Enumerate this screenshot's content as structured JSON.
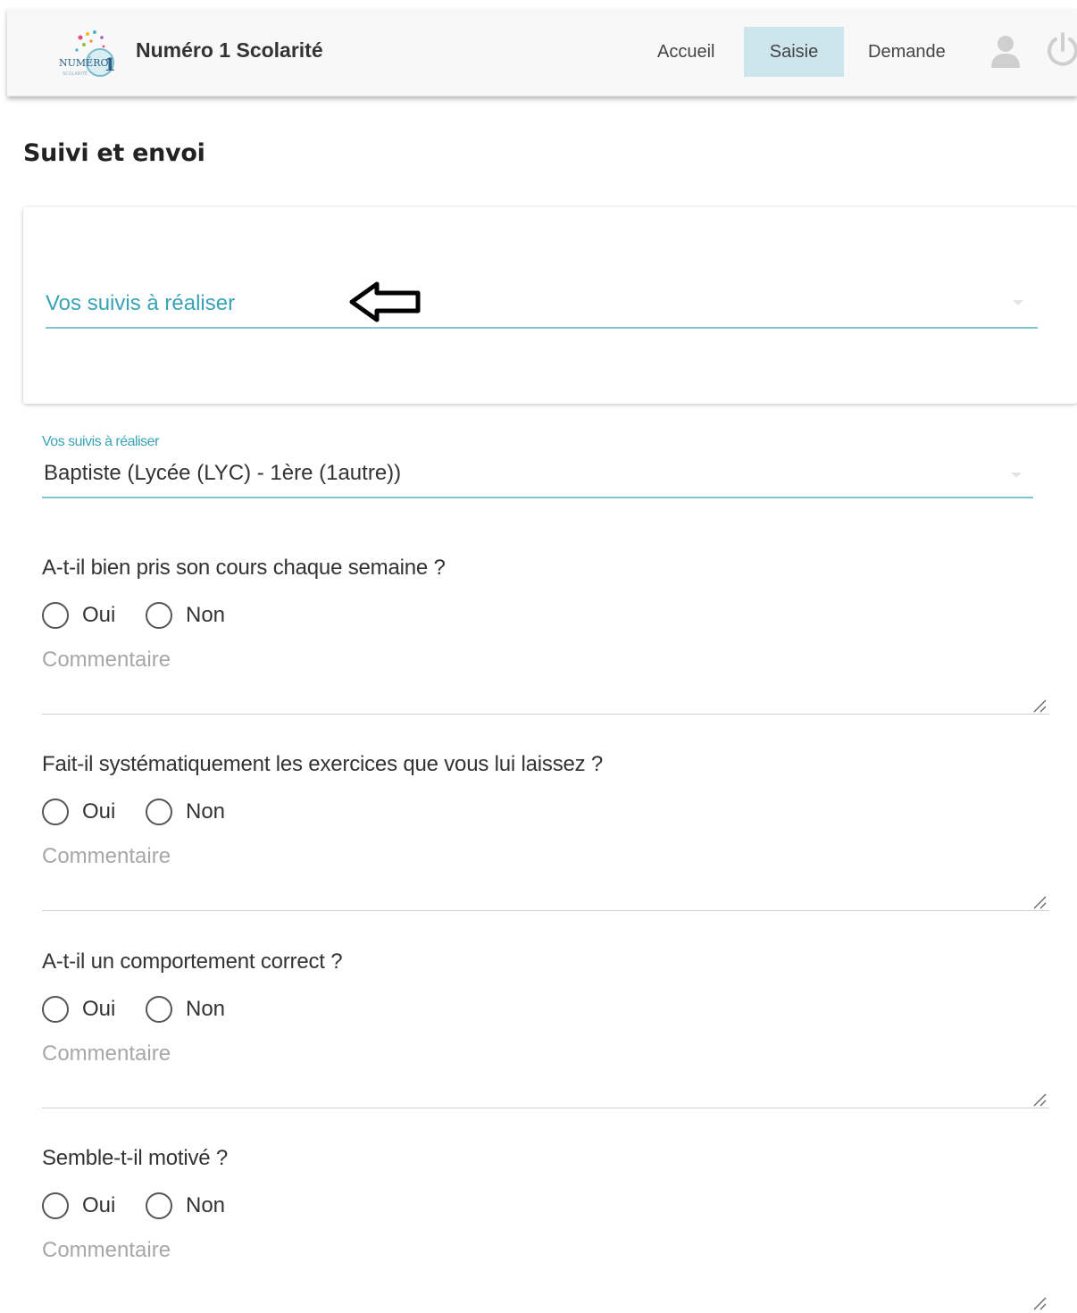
{
  "header": {
    "brand": "Numéro 1 Scolarité",
    "nav": [
      {
        "label": "Accueil"
      },
      {
        "label": "Saisie",
        "active": true
      },
      {
        "label": "Demande"
      }
    ],
    "icons": [
      "user-icon",
      "power-icon"
    ],
    "active_color": "#cde6ec"
  },
  "page": {
    "title": "Suivi et envoi"
  },
  "card_select": {
    "label": "Vos suivis à réaliser",
    "accent_color": "#38a3b6"
  },
  "selected_field": {
    "label": "Vos suivis à réaliser",
    "value": "Baptiste (Lycée (LYC) - 1ère (1autre))"
  },
  "questions": [
    {
      "text": "A-t-il bien pris son cours chaque semaine ?",
      "option_yes": "Oui",
      "option_no": "Non",
      "comment_placeholder": "Commentaire"
    },
    {
      "text": "Fait-il systématiquement les exercices que vous lui laissez ?",
      "option_yes": "Oui",
      "option_no": "Non",
      "comment_placeholder": "Commentaire"
    },
    {
      "text": "A-t-il un comportement correct ?",
      "option_yes": "Oui",
      "option_no": "Non",
      "comment_placeholder": "Commentaire"
    },
    {
      "text": "Semble-t-il motivé ?",
      "option_yes": "Oui",
      "option_no": "Non",
      "comment_placeholder": "Commentaire"
    }
  ]
}
